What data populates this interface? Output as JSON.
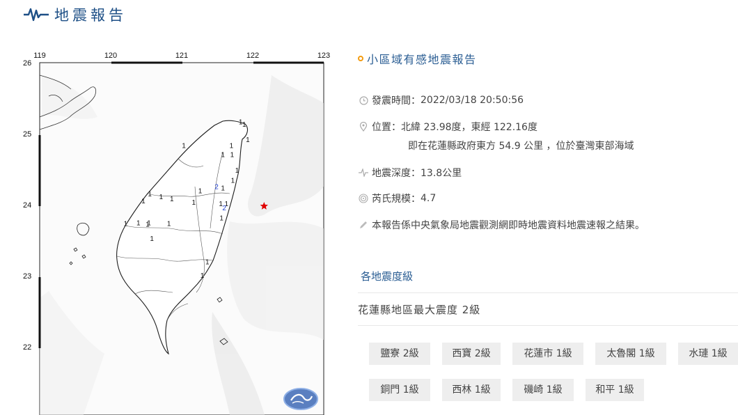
{
  "header": {
    "title": "地震報告",
    "icon": "seismic-wave-icon"
  },
  "map": {
    "lon_ticks": [
      "119",
      "120",
      "121",
      "122",
      "123"
    ],
    "lat_ticks": [
      "26",
      "25",
      "24",
      "23",
      "22"
    ],
    "epicenter": {
      "lat": 23.98,
      "lon": 122.16
    },
    "station_marks": [
      {
        "label": "1",
        "lat": 25.13,
        "lon": 121.83
      },
      {
        "label": "1",
        "lat": 25.1,
        "lon": 121.88
      },
      {
        "label": "1",
        "lat": 24.88,
        "lon": 121.93
      },
      {
        "label": "1",
        "lat": 24.8,
        "lon": 121.03
      },
      {
        "label": "1",
        "lat": 24.8,
        "lon": 121.7
      },
      {
        "label": "1",
        "lat": 24.67,
        "lon": 121.58
      },
      {
        "label": "1",
        "lat": 24.67,
        "lon": 121.71
      },
      {
        "label": "1",
        "lat": 24.45,
        "lon": 121.78
      },
      {
        "label": "1",
        "lat": 24.31,
        "lon": 121.72
      },
      {
        "label": "2",
        "lat": 24.22,
        "lon": 121.49
      },
      {
        "label": "1",
        "lat": 24.2,
        "lon": 121.58
      },
      {
        "label": "1",
        "lat": 24.16,
        "lon": 121.26
      },
      {
        "label": "1",
        "lat": 24.12,
        "lon": 120.55
      },
      {
        "label": "1",
        "lat": 24.08,
        "lon": 120.71
      },
      {
        "label": "1",
        "lat": 24.05,
        "lon": 120.86
      },
      {
        "label": "1",
        "lat": 24.02,
        "lon": 120.46
      },
      {
        "label": "1",
        "lat": 24.0,
        "lon": 121.17
      },
      {
        "label": "1",
        "lat": 23.98,
        "lon": 121.55
      },
      {
        "label": "1",
        "lat": 23.98,
        "lon": 121.63
      },
      {
        "label": "2",
        "lat": 23.92,
        "lon": 121.6
      },
      {
        "label": "1",
        "lat": 23.78,
        "lon": 121.56
      },
      {
        "label": "1",
        "lat": 23.71,
        "lon": 120.54
      },
      {
        "label": "1",
        "lat": 23.71,
        "lon": 120.39
      },
      {
        "label": "1",
        "lat": 23.7,
        "lon": 120.21
      },
      {
        "label": "1",
        "lat": 23.7,
        "lon": 120.82
      },
      {
        "label": "1",
        "lat": 23.69,
        "lon": 120.52
      },
      {
        "label": "1",
        "lat": 23.49,
        "lon": 120.58
      },
      {
        "label": "1",
        "lat": 23.16,
        "lon": 121.36
      },
      {
        "label": "1",
        "lat": 22.97,
        "lon": 121.29
      }
    ]
  },
  "report": {
    "title": "小區域有感地震報告",
    "time_label": "發震時間：",
    "time_value": "2022/03/18 20:50:56",
    "location_label": "位置：",
    "location_value": "北緯 23.98度，東經 122.16度",
    "location_detail": "即在花蓮縣政府東方 54.9 公里 ，位於臺灣東部海域",
    "depth_label": "地震深度：",
    "depth_value": "13.8公里",
    "magnitude_label": "芮氏規模：",
    "magnitude_value": "4.7",
    "note": "本報告係中央氣象局地震觀測網即時地震資料地震速報之結果。"
  },
  "intensity": {
    "section_title": "各地震度級",
    "max_text": "花蓮縣地區最大震度 2級",
    "stations": [
      "鹽寮 2級",
      "西寶 2級",
      "花蓮市 1級",
      "太魯閣 1級",
      "水璉 1級",
      "銅門 1級",
      "西林 1級",
      "磯崎 1級",
      "和平 1級"
    ]
  },
  "colors": {
    "accent": "#1d4f86",
    "epicenter": "#e00000",
    "chip_bg": "#eeeeee",
    "orange": "#f39c12"
  }
}
